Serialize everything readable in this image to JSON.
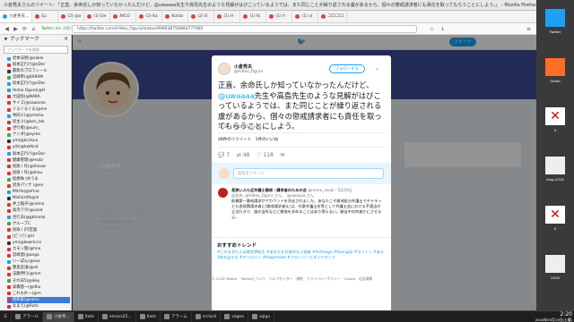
{
  "window": {
    "title": "小倉秀夫さんのツイート: 「正直、余命氏しか知っていなかったんだけど、@uwaaaa先生や高島先生のような見解がはびこっているようでは、また同じことが繰り返される虞があるから、個々の懲戒請求者にも責任を取ってもらうことにしよう。」 - Mozilla Firefox"
  },
  "tabs": [
    {
      "label": "小倉秀夫...",
      "icon": "twitter"
    },
    {
      "label": "Ep",
      "icon": "red"
    },
    {
      "label": "(2) @a",
      "icon": "red"
    },
    {
      "label": "(1) De",
      "icon": "red"
    },
    {
      "label": "NICO",
      "icon": "red"
    },
    {
      "label": "(2) Ka",
      "icon": "red"
    },
    {
      "label": "Kotob",
      "icon": "red"
    },
    {
      "label": "(2) B",
      "icon": "red"
    },
    {
      "label": "(1) H",
      "icon": "red"
    },
    {
      "label": "(1) Ki",
      "icon": "red"
    },
    {
      "label": "(1) h",
      "icon": "red"
    },
    {
      "label": "(1) al",
      "icon": "red"
    },
    {
      "label": "コロコロ",
      "icon": "red"
    }
  ],
  "nav": {
    "url": "https://twitter.com/Hideo_Ogura/status/998038758884777985",
    "page_label": "Twitter, Inc. (US)"
  },
  "sidebar": {
    "title": "ブックマーク",
    "search_placeholder": "ブックマークを検索",
    "items": [
      {
        "label": "岩本法男(@sakai"
      },
      {
        "label": "坂本正行(Y@nDer"
      },
      {
        "label": "最新のプロフィール"
      },
      {
        "label": "宮崎県(@KARAM"
      },
      {
        "label": "坂本正行(Y@nDer"
      },
      {
        "label": "Hideo Ogura(@H"
      },
      {
        "label": "大田恒(@NAKA"
      },
      {
        "label": "サイズ(@sawaraa"
      },
      {
        "label": "ぐるぐるぐる(@mn"
      },
      {
        "label": "共同ミ(@ymzma"
      },
      {
        "label": "民主ミ(@ken_tak"
      },
      {
        "label": "世行者(@sum_"
      },
      {
        "label": "ナンダ(@eyrka"
      },
      {
        "label": "ym(@kcirkuo"
      },
      {
        "label": "yrb(@kwtknd"
      },
      {
        "label": "坂本正行(Y@nDer"
      },
      {
        "label": "健康管理(@mobi"
      },
      {
        "label": "民政 I 作(@zhouw"
      },
      {
        "label": "民政 I 作(@zhou"
      },
      {
        "label": "仮想株 (ゆうま"
      },
      {
        "label": "岩垣パソナ (@en"
      },
      {
        "label": "Mitrfe(@efrne"
      },
      {
        "label": "Mishi(ntfk@nl"
      },
      {
        "label": "井上稲子(@nemo"
      },
      {
        "label": "高浜ワタ(@oisat"
      },
      {
        "label": "世行あ(@gktnmal"
      },
      {
        "label": "グループC"
      },
      {
        "label": "民政 I (円堂喜"
      },
      {
        "label": "(ビ I (!) @U"
      },
      {
        "label": "ym(@kewrkcrz"
      },
      {
        "label": "カモン聖(@hna"
      },
      {
        "label": "宮崎悠(@anga"
      },
      {
        "label": "いーぽん(@sea"
      },
      {
        "label": "豊島宮浅(@ah"
      },
      {
        "label": "法路伸行(@mm"
      },
      {
        "label": "それ日5(@ikey"
      },
      {
        "label": "高橋悠一(@dhu"
      },
      {
        "label": "これも片一(@m"
      },
      {
        "label": "昭和家(@rams"
      },
      {
        "label": "なまえ(@Ruta"
      }
    ]
  },
  "profile": {
    "name": "小倉秀夫",
    "handle": "@Hideo_Ogura",
    "bio": "そうしいは、法とコンピュータ学会や慣都教会とかで、情報法制と関する研究を行っています。ただし、私の主張の内容が出版されている前提であり法律では、自体を掲載しています。",
    "location": "Tokyo/Minato-ku/Japan",
    "link": "hideo_ogura.com",
    "joined": "2009年6月に登録"
  },
  "tweet": {
    "name": "小倉秀夫",
    "handle": "@Hideo_Ogura",
    "follow_label": "フォローする",
    "text_before": "正直、余命氏しか知っていなかったんだけど、",
    "mention": "@uwaaaa",
    "text_after": "先生や高島先生のような見解がはびこっているようでは、また同じことが繰り返される虞があるから、個々の懲戒請求者にも責任を取ってもらうことにしよう。",
    "time": "19:25 - 2018年5月19日",
    "stats": "48件のリツイート　1件のいいね",
    "reply_counts": [
      "7",
      "48",
      "118"
    ],
    "reply_placeholder": "返信をツイート"
  },
  "reply": {
    "author": "長狭いぶら近弁護士懲戒・請求者のための会",
    "handle": "@nmno_nasai",
    "date": "5月19日",
    "to": "返信先: @Hideo_Ogura さん、 @uwaaaa さん",
    "text": "前橋第一懲戒請求がアカウントを消去されました。あなたこそ懲戒処分弁護士でチヤラッとも直接関請求者に(懲戒請求者)には、任意弁護士名等として弁護士会における不適当が立法行きで、誰の当所などに懲戒を求めることはあり得えない。御当中の何者かにさせるよ。",
    "more": "返信をさらに表示"
  },
  "trends": {
    "title": "おすすめトレンド",
    "items": "#これを見た人は異世界転生 #あなたを好意的な人物者 #Ashikaga #Kanngaji #スペイン #ある1枚を出すな #デトロイト #Hagertowe #フローバーとダイヤモンド"
  },
  "footer": "© 2018 Twitter　Twitterについて　ヘルプセンター　規約　プライバシーポリシー　Cookie　広告情報",
  "taskbar": {
    "items": [
      {
        "label": "アラール"
      },
      {
        "label": "小倉秀..."
      },
      {
        "label": "Kate"
      },
      {
        "label": "emacs25..."
      },
      {
        "label": "Kate"
      },
      {
        "label": "アラーム"
      },
      {
        "label": "srclock"
      },
      {
        "label": "sageo"
      },
      {
        "label": "sqlgo"
      }
    ],
    "time": "2:20",
    "date": "2018年05月19日(土曜)"
  },
  "desktop": {
    "icons": [
      {
        "label": "Twitter"
      },
      {
        "label": "Gitlab"
      },
      {
        "label": "X"
      },
      {
        "label": "blog-2018"
      },
      {
        "label": "X"
      },
      {
        "label": "2018"
      }
    ]
  }
}
